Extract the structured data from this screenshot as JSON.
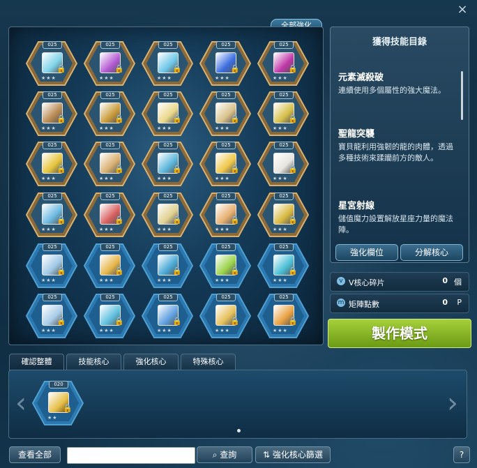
{
  "top": {
    "all_enhance": "全部強化",
    "close": "×"
  },
  "grid": {
    "rows": [
      [
        {
          "level": "025",
          "frame": "gold",
          "color": "#7fd3e8"
        },
        {
          "level": "025",
          "frame": "gold",
          "color": "#b35ad3"
        },
        {
          "level": "025",
          "frame": "gold",
          "color": "#6fc7e8"
        },
        {
          "level": "025",
          "frame": "gold",
          "color": "#3a6de0"
        },
        {
          "level": "025",
          "frame": "gold",
          "color": "#c036a8"
        }
      ],
      [
        {
          "level": "025",
          "frame": "gold",
          "color": "#b98a52"
        },
        {
          "level": "025",
          "frame": "gold",
          "color": "#c99b3a"
        },
        {
          "level": "025",
          "frame": "gold",
          "color": "#e9d88a"
        },
        {
          "level": "025",
          "frame": "gold",
          "color": "#d9c28a"
        },
        {
          "level": "025",
          "frame": "gold",
          "color": "#d7c04a"
        }
      ],
      [
        {
          "level": "025",
          "frame": "gold",
          "color": "#e6c43a"
        },
        {
          "level": "025",
          "frame": "gold",
          "color": "#d8b070"
        },
        {
          "level": "025",
          "frame": "gold",
          "color": "#5cb7da"
        },
        {
          "level": "025",
          "frame": "gold",
          "color": "#f0c84a"
        },
        {
          "level": "025",
          "frame": "gold",
          "color": "#e7e6e0"
        }
      ],
      [
        {
          "level": "025",
          "frame": "gold",
          "color": "#6ab8e0"
        },
        {
          "level": "025",
          "frame": "gold",
          "color": "#d86060"
        },
        {
          "level": "025",
          "frame": "gold",
          "color": "#e0d090"
        },
        {
          "level": "025",
          "frame": "gold",
          "color": "#e8b070"
        },
        {
          "level": "025",
          "frame": "gold",
          "color": "#d9b940"
        }
      ],
      [
        {
          "level": "025",
          "frame": "blue",
          "color": "#9fc8e6"
        },
        {
          "level": "025",
          "frame": "blue",
          "color": "#e5b64a"
        },
        {
          "level": "025",
          "frame": "blue",
          "color": "#4aa9d6"
        },
        {
          "level": "025",
          "frame": "blue",
          "color": "#9ad34a"
        },
        {
          "level": "025",
          "frame": "blue",
          "color": "#4abfd6"
        }
      ],
      [
        {
          "level": "025",
          "frame": "blue",
          "color": "#a8cce8"
        },
        {
          "level": "025",
          "frame": "blue",
          "color": "#5fc0e0"
        },
        {
          "level": "025",
          "frame": "blue",
          "color": "#5fa0e0"
        },
        {
          "level": "025",
          "frame": "blue",
          "color": "#e6c05a"
        },
        {
          "level": "025",
          "frame": "blue",
          "color": "#e8a040"
        }
      ]
    ]
  },
  "info": {
    "title": "獲得技能目錄",
    "skills": [
      {
        "name": "元素滅殺破",
        "desc": "連續使用多個屬性的強大魔法。"
      },
      {
        "name": "聖龍突襲",
        "desc": "寶貝龍利用強韌的龍的肉體，透過多種技術來蹂躪前方的敵人。"
      },
      {
        "name": "星宮射線",
        "desc": "儲值魔力設置解放星座力量的魔法陣。"
      }
    ],
    "btn_enhance_slot": "強化欄位",
    "btn_decompose": "分解核心"
  },
  "stats": [
    {
      "icon": "v",
      "label": "V核心碎片",
      "value": "0",
      "unit": "個"
    },
    {
      "icon": "m",
      "label": "矩陣點數",
      "value": "0",
      "unit": "P"
    }
  ],
  "craft_mode": "製作模式",
  "tabs": [
    "確認整體",
    "技能核心",
    "強化核心",
    "特殊核心"
  ],
  "list": {
    "items": [
      {
        "level": "020",
        "color": "#e6c04a"
      }
    ]
  },
  "bottom": {
    "view_all": "查看全部",
    "search_placeholder": "",
    "search_btn": "查詢",
    "filter_btn": "強化核心篩選",
    "help": "?"
  }
}
